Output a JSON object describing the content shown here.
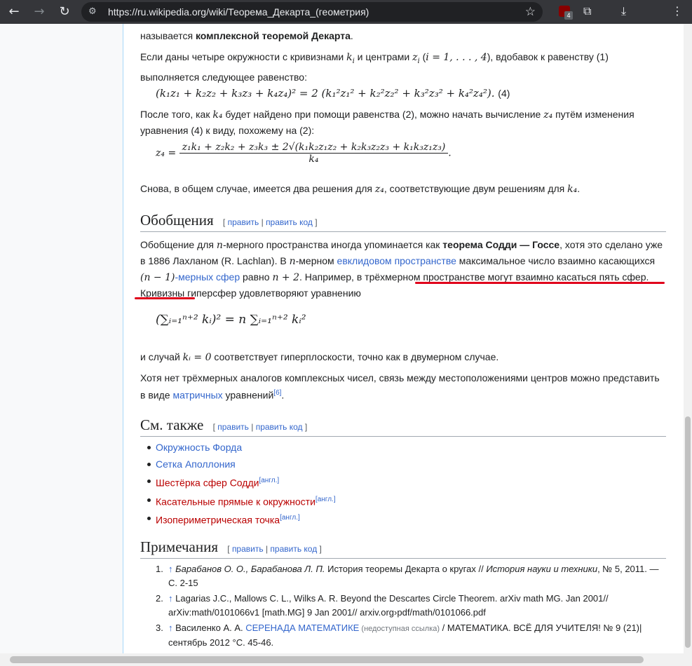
{
  "browser": {
    "url": "https://ru.wikipedia.org/wiki/Теорема_Декарта_(геометрия)",
    "back_icon": "←",
    "forward_icon": "→",
    "reload_icon": "↻",
    "star_icon": "☆",
    "extension_badge": "4",
    "ext_icon": "⧉",
    "download_icon": "⤓",
    "menu_icon": "⋮"
  },
  "article": {
    "intro_line": {
      "pre": "называется ",
      "bold": "комплексной теоремой Декарта",
      "post": "."
    },
    "p_complex": {
      "a": "Если даны четыре окружности с кривизнами ",
      "k": "k",
      "ki": "i",
      "b": " и центрами ",
      "z": "z",
      "zi": "i",
      "c": " (",
      "range": "i = 1, . . . , 4",
      "d": "), вдобавок к равенству (1) выполняется следующее равенство:"
    },
    "eq4": "(k₁z₁ + k₂z₂ + k₃z₃ + k₄z₄)² = 2 (k₁²z₁² + k₂²z₂² + k₃²z₃² + k₄²z₄²).",
    "eq4_label": "(4)",
    "p_after": {
      "a": "После того, как ",
      "k4": "k₄",
      "b": " будет найдено при помощи равенства (2), можно начать вычисление ",
      "z4": "z₄",
      "c": " путём изменения уравнения (4) к виду, похожему на (2):"
    },
    "eq_z4_lhs": "z₄ =",
    "eq_z4_num": "z₁k₁ + z₂k₂ + z₃k₃ ± 2√(k₁k₂z₁z₂ + k₂k₃z₂z₃ + k₁k₃z₁z₃)",
    "eq_z4_den": "k₄",
    "eq_z4_end": ".",
    "p_two": {
      "a": "Снова, в общем случае, имеется два решения для ",
      "z4": "z₄",
      "b": ", соответствующие двум решениям для ",
      "k4": "k₄",
      "c": "."
    },
    "h_general": "Обобщения",
    "edit_open": "[ ",
    "edit_label": "править",
    "edit_sep": " | ",
    "edit_code_label": "править код",
    "edit_close": " ]",
    "p_general": {
      "a": "Обобщение для ",
      "n": "n",
      "b": "-мерного пространства иногда упоминается как ",
      "bold": "теорема Содди — Госсе",
      "c": ", хотя это сделано уже в 1886 Лахланом (R. Lachlan). В ",
      "n2": "n",
      "d": "-мерном ",
      "link1": "евклидовом пространстве",
      "e": " максимальное число взаимно касающихся ",
      "n1": "(n − 1)",
      "link2": "-мерных сфер",
      "f": " равно ",
      "n_plus": "n + 2",
      "g": ". Например, ",
      "hl": "в трёхмерном пространстве могут взаимно касаться пять сфер",
      "h": ". Кривизны гиперсфер удовлетворяют уравнению"
    },
    "eq_sum": "(∑ᵢ₌₁ⁿ⁺² kᵢ)² = n ∑ᵢ₌₁ⁿ⁺² kᵢ²",
    "p_case": {
      "a": "и случай ",
      "ki0": "kᵢ = 0",
      "b": " соответствует гиперплоскости, точно как в двумерном случае."
    },
    "p_complex2": {
      "a": "Хотя нет трёхмерных аналогов комплексных чисел, связь между местоположениями центров можно представить в виде ",
      "link": "матричных",
      "b": " уравнений",
      "ref": "[6]",
      "c": "."
    },
    "h_see": "См. также",
    "see_also": [
      {
        "label": "Окружность Форда",
        "red": false,
        "sup": ""
      },
      {
        "label": "Сетка Аполлония",
        "red": false,
        "sup": ""
      },
      {
        "label": "Шестёрка сфер Содди",
        "red": true,
        "sup": "[англ.]"
      },
      {
        "label": "Касательные прямые к окружности",
        "red": true,
        "sup": "[англ.]"
      },
      {
        "label": "Изопериметрическая точка",
        "red": true,
        "sup": "[англ.]"
      }
    ],
    "h_notes": "Примечания",
    "notes": [
      {
        "num": "1.",
        "arrow": "↑",
        "text_i": "Барабанов О. О., Барабанова Л. П.",
        "text": " История теоремы Декарта о кругах // ",
        "text_i2": "История науки и техники",
        "text2": ", № 5, 2011. — С. 2-15"
      },
      {
        "num": "2.",
        "arrow": "↑",
        "text_i": "",
        "text": "Lagarias J.C., Mallows C. L., Wilks A. R. Beyond the Descartes Circle Theorem. arXiv math MG. Jan 2001// arXiv:math/0101066v1 [math.MG] 9 Jan 2001// arxiv.org›pdf/math/0101066.pdf",
        "text_i2": "",
        "text2": ""
      },
      {
        "num": "3.",
        "arrow": "↑",
        "text_i": "",
        "text": "Василенко А. А. ",
        "link": "СЕРЕНАДА МАТЕМАТИКЕ",
        "dead": " (недоступная ссылка)",
        "text2": " / МАТЕМАТИКА. ВСЁ ДЛЯ УЧИТЕЛЯ! № 9 (21)| сентябрь 2012 °С. 45-46."
      }
    ]
  }
}
